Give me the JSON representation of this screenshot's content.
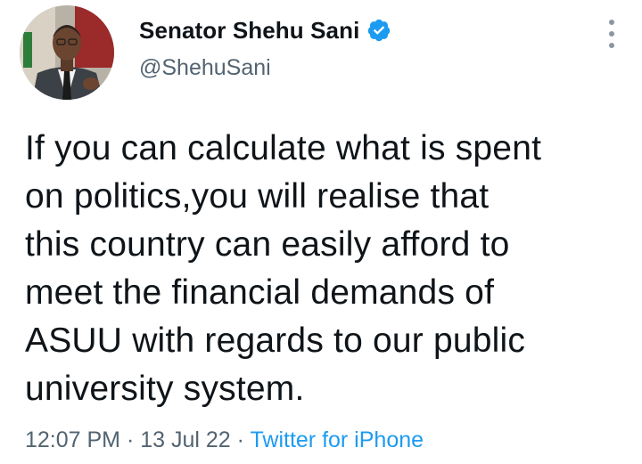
{
  "author": {
    "display_name": "Senator Shehu Sani",
    "handle": "@ShehuSani",
    "verified": true,
    "verified_color": "#1d9bf0"
  },
  "tweet": {
    "text": "If you can calculate what is spent\non politics,you will realise that\nthis country can easily afford to\nmeet the financial demands of\nASUU with regards to our public\nuniversity system."
  },
  "meta": {
    "time": "12:07 PM",
    "separator": "·",
    "date": "13 Jul 22",
    "source": "Twitter for iPhone"
  },
  "icons": {
    "avatar": "profile-photo",
    "verified": "verified-badge-icon",
    "more": "more-vertical-icon"
  }
}
